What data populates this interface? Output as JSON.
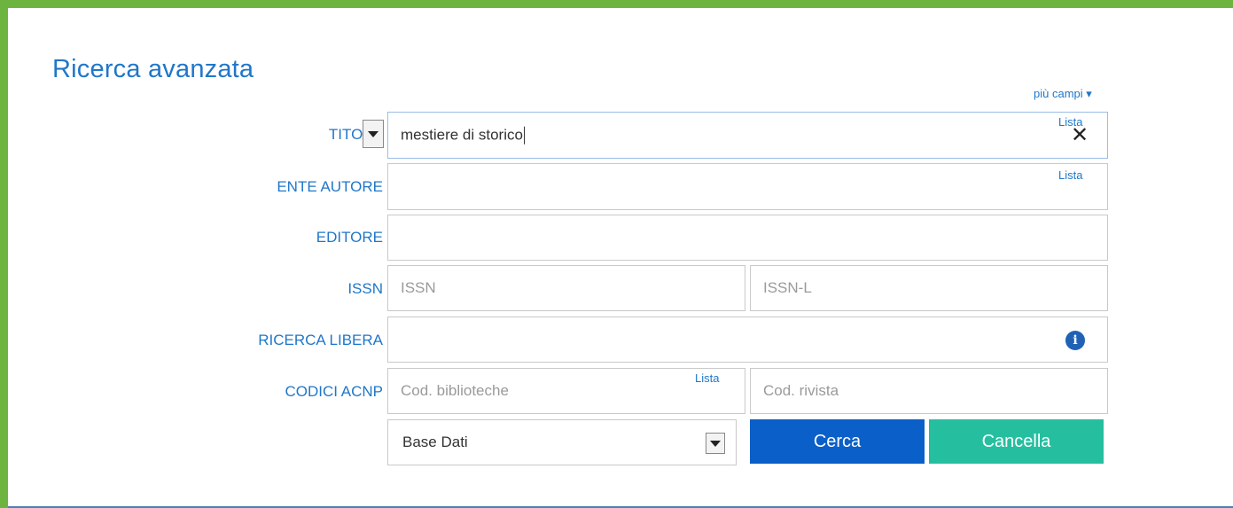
{
  "header": {
    "title": "Ricerca avanzata",
    "more_fields": "più campi ▾"
  },
  "form": {
    "title_label": "TITOLO",
    "title_value": "mestiere di storico",
    "lista_label": "Lista",
    "ente_autore_label": "ENTE AUTORE",
    "editore_label": "EDITORE",
    "issn_label": "ISSN",
    "issn_placeholder": "ISSN",
    "issnl_placeholder": "ISSN-L",
    "ricerca_libera_label": "RICERCA LIBERA",
    "codici_label": "CODICI ACNP",
    "cod_biblioteche_placeholder": "Cod. biblioteche",
    "cod_rivista_placeholder": "Cod. rivista",
    "base_dati_value": "Base Dati",
    "cerca_label": "Cerca",
    "cancella_label": "Cancella",
    "info_glyph": "i",
    "clear_glyph": "✕"
  },
  "colors": {
    "frame": "#6db33f",
    "accent": "#1f77c9",
    "cerca": "#0a5fc8",
    "cancella": "#25bfa0"
  }
}
